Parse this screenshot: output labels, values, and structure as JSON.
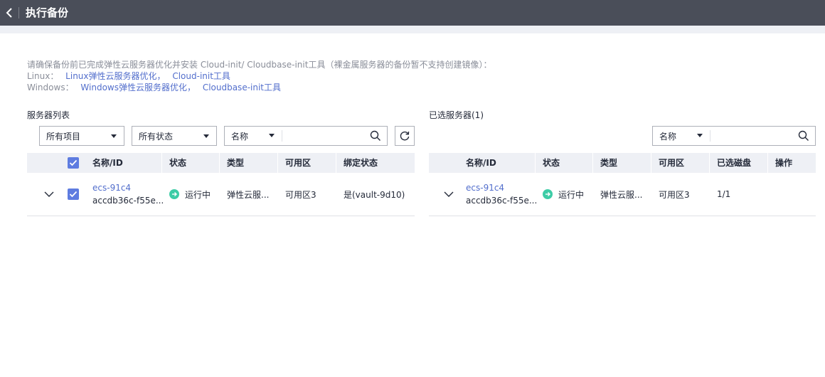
{
  "header": {
    "title": "执行备份",
    "back_icon": "chevron-left-icon"
  },
  "notice": {
    "line1": "请确保备份前已完成弹性云服务器优化并安装 Cloud-init/ Cloudbase-init工具（裸金属服务器的备份暂不支持创建镜像）：",
    "linux_label": "Linux：",
    "linux_link1": "Linux弹性云服务器优化，",
    "linux_link2": "Cloud-init工具",
    "windows_label": "Windows：",
    "windows_link1": "Windows弹性云服务器优化，",
    "windows_link2": "Cloudbase-init工具"
  },
  "left": {
    "title": "服务器列表",
    "filter_project": "所有项目",
    "filter_status": "所有状态",
    "search_field": "名称",
    "search_placeholder": "",
    "columns": [
      "名称/ID",
      "状态",
      "类型",
      "可用区",
      "绑定状态"
    ],
    "rows": [
      {
        "name": "ecs-91c4",
        "id": "accdb36c-f55e...",
        "status": "运行中",
        "type": "弹性云服...",
        "az": "可用区3",
        "bind": "是(vault-9d10)"
      }
    ]
  },
  "right": {
    "title": "已选服务器(1)",
    "search_field": "名称",
    "search_placeholder": "",
    "columns": [
      "名称/ID",
      "状态",
      "类型",
      "可用区",
      "已选磁盘",
      "操作"
    ],
    "rows": [
      {
        "name": "ecs-91c4",
        "id": "accdb36c-f55e...",
        "status": "运行中",
        "type": "弹性云服...",
        "az": "可用区3",
        "disks": "1/1"
      }
    ]
  },
  "colors": {
    "header_bg": "#4a4e59",
    "link": "#526ecc",
    "checkbox": "#5e7ce0",
    "status_running": "#3dcca6",
    "table_header_bg": "#eef0f5"
  }
}
